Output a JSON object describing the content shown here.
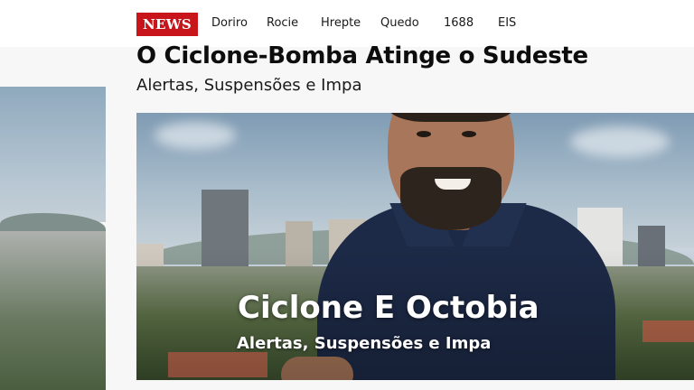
{
  "brand": {
    "logo_text": "NEWS",
    "accent_color": "#c8151b"
  },
  "nav": {
    "items": [
      {
        "label": "Doriro"
      },
      {
        "label": "Rocie"
      },
      {
        "label": "Hrepte"
      },
      {
        "label": "Quedo"
      },
      {
        "label": "1688"
      },
      {
        "label": "EIS"
      }
    ]
  },
  "article": {
    "headline": "O Ciclone-Bomba Atinge o Sudeste",
    "subheadline": "Alertas, Suspensões e Impa"
  },
  "hero": {
    "title": "Ciclone E Octobia",
    "subtitle": "Alertas, Suspensões e Impa"
  }
}
